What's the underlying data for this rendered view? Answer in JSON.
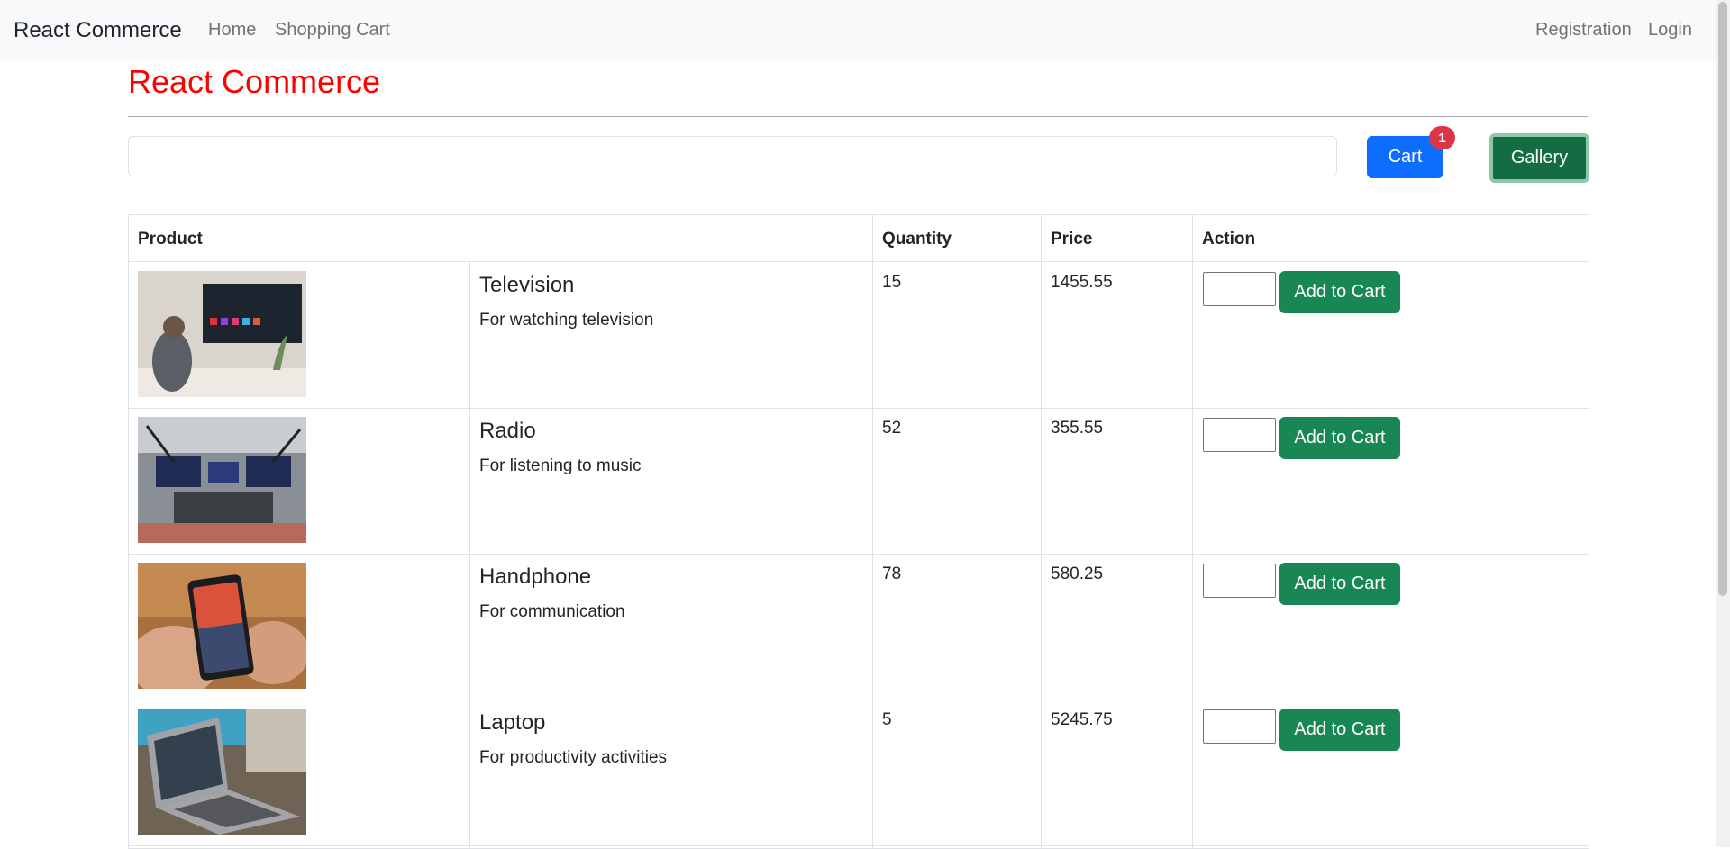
{
  "navbar": {
    "brand": "React Commerce",
    "links": [
      "Home",
      "Shopping Cart"
    ],
    "right_links": [
      "Registration",
      "Login"
    ]
  },
  "page": {
    "title": "React Commerce",
    "search": {
      "value": "",
      "placeholder": ""
    },
    "cart_label": "Cart",
    "cart_count": "1",
    "gallery_label": "Gallery"
  },
  "table": {
    "headers": [
      "Product",
      "Quantity",
      "Price",
      "Action"
    ],
    "rows": [
      {
        "name": "Television",
        "description": "For watching television",
        "quantity": "15",
        "price": "1455.55",
        "action_label": "Add to Cart",
        "image": "television-photo"
      },
      {
        "name": "Radio",
        "description": "For listening to music",
        "quantity": "52",
        "price": "355.55",
        "action_label": "Add to Cart",
        "image": "radio-studio-photo"
      },
      {
        "name": "Handphone",
        "description": "For communication",
        "quantity": "78",
        "price": "580.25",
        "action_label": "Add to Cart",
        "image": "handphone-photo"
      },
      {
        "name": "Laptop",
        "description": "For productivity activities",
        "quantity": "5",
        "price": "5245.75",
        "action_label": "Add to Cart",
        "image": "laptop-photo"
      }
    ]
  },
  "colors": {
    "title": "#ff0000",
    "cart_button": "#0d6efd",
    "badge": "#dc3545",
    "gallery_button": "#146c43",
    "add_button": "#198754"
  }
}
